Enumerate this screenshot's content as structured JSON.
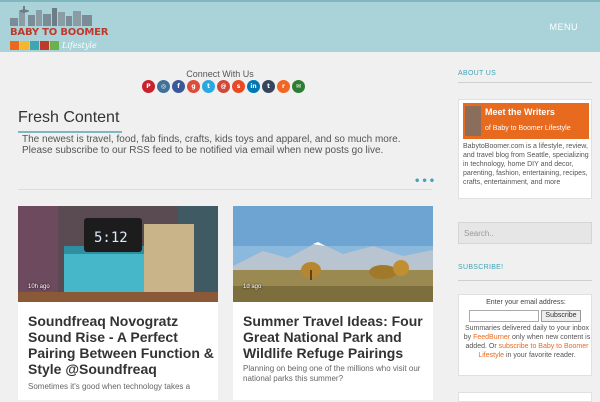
{
  "header": {
    "logo_text": "BABY TO BOOMER",
    "logo_life": "Lifestyle",
    "menu_label": "MENU"
  },
  "connect": {
    "label": "Connect With Us",
    "icons": [
      {
        "name": "pinterest-icon",
        "color": "#c8232c",
        "glyph": "P"
      },
      {
        "name": "instagram-icon",
        "color": "#3f729b",
        "glyph": "◎"
      },
      {
        "name": "facebook-icon",
        "color": "#3b5998",
        "glyph": "f"
      },
      {
        "name": "google-plus-icon",
        "color": "#dd4b39",
        "glyph": "g"
      },
      {
        "name": "twitter-icon",
        "color": "#2aa9e0",
        "glyph": "t"
      },
      {
        "name": "email-icon",
        "color": "#d14836",
        "glyph": "@"
      },
      {
        "name": "stumbleupon-icon",
        "color": "#eb4924",
        "glyph": "s"
      },
      {
        "name": "linkedin-icon",
        "color": "#0077b5",
        "glyph": "in"
      },
      {
        "name": "tumblr-icon",
        "color": "#35465c",
        "glyph": "t"
      },
      {
        "name": "rss-icon",
        "color": "#f26522",
        "glyph": "r"
      },
      {
        "name": "feedburner-icon",
        "color": "#2e7d32",
        "glyph": "✉"
      }
    ]
  },
  "fresh": {
    "title": "Fresh Content",
    "description": "The newest is travel, food, fab finds, crafts, kids toys and apparel, and so much more. Please subscribe to our RSS feed to be notified via email when new posts go live.",
    "more": "•••"
  },
  "posts": [
    {
      "ago": "10h ago",
      "title": "Soundfreaq Novogratz Sound Rise - A Perfect Pairing Between Function & Style @Soundfreaq",
      "excerpt": "Sometimes it's good when technology takes a",
      "clock": "5:12"
    },
    {
      "ago": "1d ago",
      "title": "Summer Travel Ideas: Four Great National Park and Wildlife Refuge Pairings",
      "excerpt": "Planning on being one of the millions who visit our national parks this summer?"
    }
  ],
  "sidebar": {
    "about_heading": "ABOUT US",
    "meet_title": "Meet the Writers",
    "meet_sub": "of Baby to Boomer Lifestyle",
    "about_text": "BabytoBoomer.com is a lifestyle, review, and travel blog from Seattle, specializing in technology, home DIY and decor, parenting, fashion, entertaining, recipes, crafts, entertainment, and more",
    "search_placeholder": "Search..",
    "subscribe_heading": "SUBSCRIBE!",
    "email_label": "Enter your email address:",
    "subscribe_button": "Subscribe",
    "sub_text_1": "Summaries delivered daily to your inbox by ",
    "feedburner_link": "FeedBurner",
    "sub_text_2": " only when new content is added. Or ",
    "subscribe_link": "subscribe to Baby to Boomer Lifestyle",
    "sub_text_3": " in your favorite reader."
  }
}
